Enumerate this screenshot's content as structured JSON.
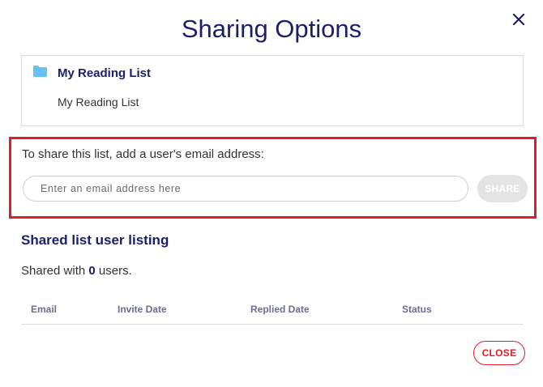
{
  "modal": {
    "title": "Sharing Options",
    "close_icon": "close-x-icon"
  },
  "list": {
    "folder_icon": "folder-icon",
    "folder_color": "#64c3ef",
    "name": "My Reading List",
    "description": "My Reading List"
  },
  "share": {
    "prompt": "To share this list, add a user's email address:",
    "email_value": "",
    "email_placeholder": "Enter an email address here",
    "share_label": "SHARE",
    "share_enabled": false,
    "highlight_color": "#e11c24"
  },
  "listing": {
    "title": "Shared list user listing",
    "count_prefix": "Shared with",
    "count": "0",
    "count_suffix": "users.",
    "columns": [
      "Email",
      "Invite Date",
      "Replied Date",
      "Status"
    ],
    "rows": []
  },
  "footer": {
    "close_label": "CLOSE"
  },
  "colors": {
    "heading": "#1b1f6b",
    "accent_red": "#e11c24",
    "disabled_button": "#e4e4e4",
    "column_header": "#6b6f8e"
  }
}
